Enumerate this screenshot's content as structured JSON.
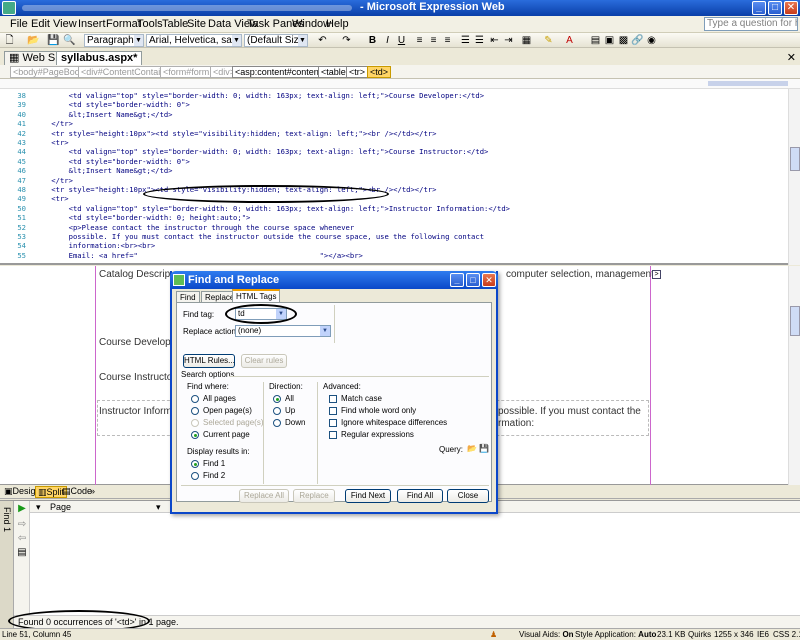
{
  "window": {
    "title": "- Microsoft Expression Web",
    "controls": {
      "minimize": "_",
      "maximize": "□",
      "close": "✕"
    }
  },
  "menu": {
    "items": [
      "File",
      "Edit",
      "View",
      "Insert",
      "Format",
      "Tools",
      "Table",
      "Site",
      "Data View",
      "Task Panes",
      "Window",
      "Help"
    ],
    "help_placeholder": "Type a question for help"
  },
  "toolbar": {
    "style": "Paragraph",
    "font": "Arial, Helvetica, sans-serif",
    "size": "(Default Size)",
    "bold": "B",
    "italic": "I",
    "underline": "U"
  },
  "tabs": {
    "website": "Web Site",
    "document": "syllabus.aspx*",
    "close": "✕"
  },
  "quicktags": [
    "<body#PageBody>",
    "<div#ContentContainer>",
    "<form#form1>",
    "<div>",
    "<asp:content#content0>",
    "<table>",
    "<tr>",
    "<td>"
  ],
  "code": {
    "lines": [
      {
        "n": "38",
        "t": "        <td valign=\"top\" style=\"border-width: 0; width: 163px; text-align: left;\">Course Developer:</td>"
      },
      {
        "n": "39",
        "t": "        <td style=\"border-width: 0\">"
      },
      {
        "n": "40",
        "t": "        &lt;Insert Name&gt;</td>"
      },
      {
        "n": "41",
        "t": "    </tr>"
      },
      {
        "n": "42",
        "t": "    <tr style=\"height:10px\"><td style=\"visibility:hidden; text-align: left;\"><br /></td></tr>"
      },
      {
        "n": "43",
        "t": "    <tr>"
      },
      {
        "n": "44",
        "t": "        <td valign=\"top\" style=\"border-width: 0; width: 163px; text-align: left;\">Course Instructor:</td>"
      },
      {
        "n": "45",
        "t": "        <td style=\"border-width: 0\">"
      },
      {
        "n": "46",
        "t": "        &lt;Insert Name&gt;</td>"
      },
      {
        "n": "47",
        "t": "    </tr>"
      },
      {
        "n": "48",
        "t": "    <tr style=\"height:10px\"><td style=\"visibility:hidden; text-align: left;\"><br /></td></tr>"
      },
      {
        "n": "49",
        "t": "    <tr>"
      },
      {
        "n": "50",
        "t": "        <td valign=\"top\" style=\"border-width: 0; width: 163px; text-align: left;\">Instructor Information:</td>"
      },
      {
        "n": "51",
        "t": "        <td style=\"border-width: 0; height:auto;\">"
      },
      {
        "n": "52",
        "t": "        <p>Please contact the instructor through the course space whenever"
      },
      {
        "n": "53",
        "t": "        possible. If you must contact the instructor outside the course space, use the following contact"
      },
      {
        "n": "54",
        "t": "        information:<br><br>"
      },
      {
        "n": "55",
        "t": "        Email: <a href=\"                                          \"></a><br>"
      }
    ]
  },
  "design": {
    "catalog": "Catalog Descrip",
    "catalog_right": "computer selection, management",
    "developer": "Course Develop",
    "instructor": "Course Instructo",
    "info": "Instructor Informa",
    "info_right_1": "possible. If you must contact the",
    "info_right_2": "rmation:",
    "expand": ">"
  },
  "views": {
    "design": "Design",
    "split": "Split",
    "code": "Code",
    "more": "»"
  },
  "find_panel": {
    "side_label": "Find 1",
    "column_page": "Page",
    "status": "Found 0 occurrences of '<td>' in 1 page."
  },
  "status": {
    "position": "Line 51, Column 45",
    "visual_aids_label": "Visual Aids:",
    "visual_aids_value": "On",
    "style_app_label": "Style Application:",
    "style_app_value": "Auto",
    "size": "23.1 KB",
    "mode": "Quirks",
    "dims": "1255 x 346",
    "browser": "IE6",
    "css": "CSS 2.1"
  },
  "dialog": {
    "title": "Find and Replace",
    "tabs": [
      "Find",
      "Replace",
      "HTML Tags"
    ],
    "find_tag_label": "Find tag:",
    "find_tag_value": "td",
    "replace_action_label": "Replace action:",
    "replace_action_value": "(none)",
    "html_rules": "HTML Rules...",
    "clear_rules": "Clear rules",
    "search_options": "Search options",
    "find_where": {
      "label": "Find where:",
      "options": [
        "All pages",
        "Open page(s)",
        "Selected page(s)",
        "Current page"
      ]
    },
    "direction": {
      "label": "Direction:",
      "options": [
        "All",
        "Up",
        "Down"
      ]
    },
    "advanced": {
      "label": "Advanced:",
      "options": [
        "Match case",
        "Find whole word only",
        "Ignore whitespace differences",
        "Regular expressions"
      ]
    },
    "display_results": {
      "label": "Display results in:",
      "options": [
        "Find 1",
        "Find 2"
      ]
    },
    "query_label": "Query:",
    "buttons": {
      "replace_all": "Replace All",
      "replace": "Replace",
      "find_next": "Find Next",
      "find_all": "Find All",
      "close": "Close"
    }
  }
}
